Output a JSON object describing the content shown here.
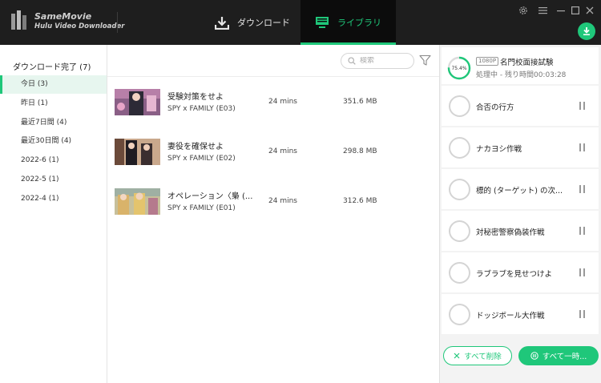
{
  "app": {
    "brand_line1": "SameMovie",
    "brand_line2": "Hulu Video Downloader"
  },
  "tabs": [
    {
      "label": "ダウンロード",
      "icon": "download-icon",
      "active": false
    },
    {
      "label": "ライブラリ",
      "icon": "monitor-icon",
      "active": true
    }
  ],
  "window_controls": [
    "settings-icon",
    "menu-icon",
    "minimize-icon",
    "maximize-icon",
    "close-icon"
  ],
  "colors": {
    "accent": "#1fc77a",
    "titlebar": "#1e1e1e"
  },
  "sidebar": {
    "title": "ダウンロード完了 (7)",
    "items": [
      {
        "label": "今日 (3)",
        "active": true
      },
      {
        "label": "昨日 (1)",
        "active": false
      },
      {
        "label": "最近7日間 (4)",
        "active": false
      },
      {
        "label": "最近30日間 (4)",
        "active": false
      },
      {
        "label": "2022-6 (1)",
        "active": false
      },
      {
        "label": "2022-5 (1)",
        "active": false
      },
      {
        "label": "2022-4 (1)",
        "active": false
      }
    ]
  },
  "search": {
    "placeholder": "検索"
  },
  "videos": [
    {
      "title": "受験対策をせよ",
      "subtitle": "SPY x FAMILY (E03)",
      "duration": "24 mins",
      "size": "351.6 MB"
    },
    {
      "title": "妻役を確保せよ",
      "subtitle": "SPY x FAMILY (E02)",
      "duration": "24 mins",
      "size": "298.8 MB"
    },
    {
      "title": "オペレーション〈梟 (...",
      "subtitle": "SPY x FAMILY (E01)",
      "duration": "24 mins",
      "size": "312.6 MB"
    }
  ],
  "queue": {
    "current": {
      "progress_label": "75.4%",
      "progress": 0.754,
      "quality": "1080P",
      "title": "名門校面接試験",
      "status": "処理中 - 残り時間00:03:28"
    },
    "items": [
      {
        "title": "合否の行方"
      },
      {
        "title": "ナカヨシ作戦"
      },
      {
        "title": "標的 (ターゲット) の次..."
      },
      {
        "title": "対秘密警察偽装作戦"
      },
      {
        "title": "ラブラブを見せつけよ"
      },
      {
        "title": "ドッジボール大作戦"
      }
    ],
    "delete_all": "すべて削除",
    "pause_all": "すべて一時..."
  }
}
